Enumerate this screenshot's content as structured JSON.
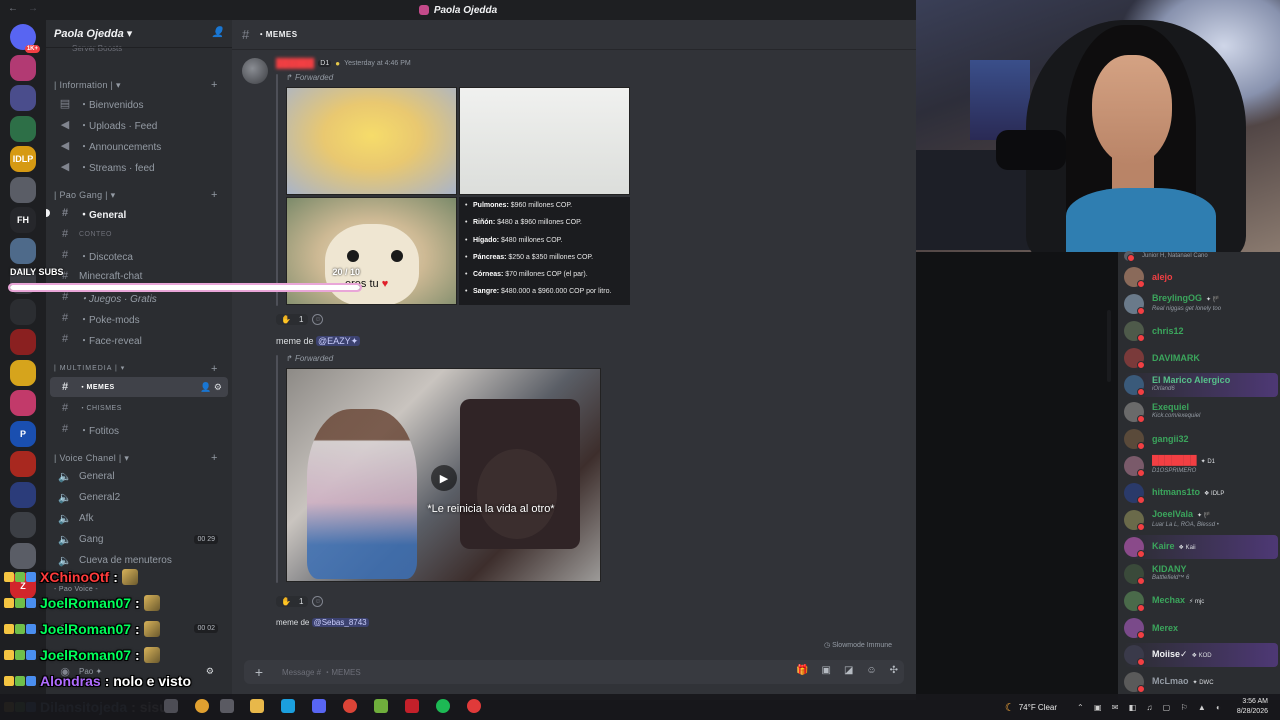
{
  "window": {
    "title": "Paola Ojedda",
    "back": "←",
    "forward": "→"
  },
  "server": {
    "name": "Paola Ojedda",
    "boosts": "Server Boosts"
  },
  "rail": {
    "badge": "1K+",
    "servers": [
      {
        "label": "",
        "color": "#5865f2"
      },
      {
        "label": "",
        "color": "#b23a73"
      },
      {
        "label": "",
        "color": "#4a4d8c"
      },
      {
        "label": "",
        "color": "#2d6f47"
      },
      {
        "label": "IDLP",
        "color": "#d69a13"
      },
      {
        "label": "",
        "color": "#5a5d66"
      },
      {
        "label": "FH",
        "color": "#26272b"
      },
      {
        "label": "",
        "color": "#4e6a8a"
      },
      {
        "label": "",
        "color": "#3a3c42"
      },
      {
        "label": "",
        "color": "#2b2d31"
      },
      {
        "label": "",
        "color": "#8a2020"
      },
      {
        "label": "",
        "color": "#d6a41c"
      },
      {
        "label": "",
        "color": "#c23a6a"
      },
      {
        "label": "P",
        "color": "#1a4fb0"
      },
      {
        "label": "",
        "color": "#a8281f"
      },
      {
        "label": "",
        "color": "#2b3c7a"
      },
      {
        "label": "",
        "color": "#3c3f45"
      },
      {
        "label": "",
        "color": "#5a5d66"
      },
      {
        "label": "Z",
        "color": "#d1252b"
      }
    ]
  },
  "sidebar": {
    "categories": {
      "information": "| Information |",
      "pao_gang": "| Pao Gang |",
      "multimedia": "| MULTIMEDIA |",
      "voice": "| Voice Chanel |",
      "pao_voice": "- Pao Voice -"
    },
    "channels": {
      "bienvenidos": "・Bienvenidos",
      "uploads": "・Uploads · Feed",
      "announcements": "・Announcements",
      "streams": "・Streams · feed",
      "general": "・General",
      "conteo": "CONTEO",
      "discoteca": "・Discoteca",
      "minecraft": "Minecraft-chat",
      "juegos": "・Juegos · Gratis",
      "pokemods": "・Poke-mods",
      "facereveal": "・Face-reveal",
      "memes": "・MEMES",
      "chismes": "・CHISMES",
      "fotitos": "・Fotitos",
      "vc_general": "General",
      "vc_general2": "General2",
      "vc_afk": "Afk",
      "vc_gang": "Gang",
      "vc_cueva": "Cueva de menuteros"
    },
    "vc_counts": {
      "gang": "00  29",
      "extra": "00  02"
    },
    "user": {
      "name": "Pao ✦"
    }
  },
  "chat": {
    "channel": "・MEMES",
    "message1": {
      "author": "██████",
      "tag": "D1",
      "time": "Yesterday at 4:46 PM",
      "forwarded": "Forwarded",
      "dog_caption": "eres tu",
      "organ_prices": [
        {
          "label": "Pulmones:",
          "value": " $960 millones COP."
        },
        {
          "label": "Riñón:",
          "value": " $480 a $960 millones COP."
        },
        {
          "label": "Hígado:",
          "value": " $480 millones COP."
        },
        {
          "label": "Páncreas:",
          "value": " $250 a $350 millones COP."
        },
        {
          "label": "Córneas:",
          "value": " $70 millones COP (el par)."
        },
        {
          "label": "Sangre:",
          "value": " $480.000 a $960.000 COP por litro."
        }
      ],
      "reaction_count": "1"
    },
    "message2": {
      "text": "meme de ",
      "mention": "@EAZY✦",
      "forwarded": "Forwarded",
      "video_caption": "*Le reinicia la vida al otro*",
      "reaction_count": "1"
    },
    "message3": {
      "text": "meme de ",
      "mention": "@Sebas_8743"
    },
    "composer_placeholder": "Message # ・MEMES",
    "slowmode": "Slowmode Immune"
  },
  "overlay": {
    "daily_subs_label": "DAILY SUBS",
    "daily_subs_count": "20 / 10",
    "daily_subs_progress": 1.0
  },
  "members": [
    {
      "name": "Junior H, Natanael Cano",
      "status": "",
      "color": "#949ba4",
      "tag": "",
      "small": true
    },
    {
      "name": "alejo",
      "status": "",
      "color": "#f23f43",
      "tag": ""
    },
    {
      "name": "BreylingOG",
      "status": "Real niggas get lonely too",
      "color": "#3ba55c",
      "tag": "✦ 🏴"
    },
    {
      "name": "chris12",
      "status": "",
      "color": "#3ba55c",
      "tag": ""
    },
    {
      "name": "DAVIMARK",
      "status": "",
      "color": "#3ba55c",
      "tag": ""
    },
    {
      "name": "El Marico Alergico",
      "status": "iOrland6",
      "color": "#57c08a",
      "tag": "",
      "hl": true
    },
    {
      "name": "Exequiel",
      "status": "Kick.com/exequiel",
      "color": "#3ba55c",
      "tag": ""
    },
    {
      "name": "gangii32",
      "status": "",
      "color": "#3ba55c",
      "tag": ""
    },
    {
      "name": "███████",
      "status": "D1OSPRIMERO",
      "color": "#f23f43",
      "tag": "✦ D1"
    },
    {
      "name": "hitmans1to",
      "status": "",
      "color": "#3ba55c",
      "tag": "❖ IDLP"
    },
    {
      "name": "JoeelVala",
      "status": "Luar La L, ROA, Blessd •",
      "color": "#3ba55c",
      "tag": "✦ 🏴"
    },
    {
      "name": "Kaire",
      "status": "",
      "color": "#3ba55c",
      "tag": "❖ Kaii",
      "hl": true
    },
    {
      "name": "KIDANY",
      "status": "Battlefield™ 6",
      "color": "#3ba55c",
      "tag": ""
    },
    {
      "name": "Mechax",
      "status": "",
      "color": "#3ba55c",
      "tag": "⚡ mjc"
    },
    {
      "name": "Merex",
      "status": "",
      "color": "#3ba55c",
      "tag": ""
    },
    {
      "name": "Moiise✓",
      "status": "",
      "color": "#f2f3f5",
      "tag": "❖ KOD",
      "hl": true
    },
    {
      "name": "McLmao",
      "status": "",
      "color": "#949ba4",
      "tag": "✦ DWC"
    }
  ],
  "stream_chat": [
    {
      "user": "XChinoOtf",
      "color": "#ff3b3b",
      "message": ":",
      "emote": true
    },
    {
      "user": "JoelRoman07",
      "color": "#00ff5a",
      "message": ":",
      "emote": true
    },
    {
      "user": "JoelRoman07",
      "color": "#00ff5a",
      "message": ":",
      "emote": true
    },
    {
      "user": "JoelRoman07",
      "color": "#00ff5a",
      "message": ":",
      "emote": true
    },
    {
      "user": "Alondras",
      "color": "#b06cff",
      "message": ": nolo e visto",
      "emote": false
    },
    {
      "user": "Dilansitojeda",
      "color": "#8ecbff",
      "message": ": sisu",
      "emote": false
    }
  ],
  "taskbar": {
    "weather": "74°F  Clear",
    "time": "3:56 AM",
    "date": "8/28/2026"
  }
}
